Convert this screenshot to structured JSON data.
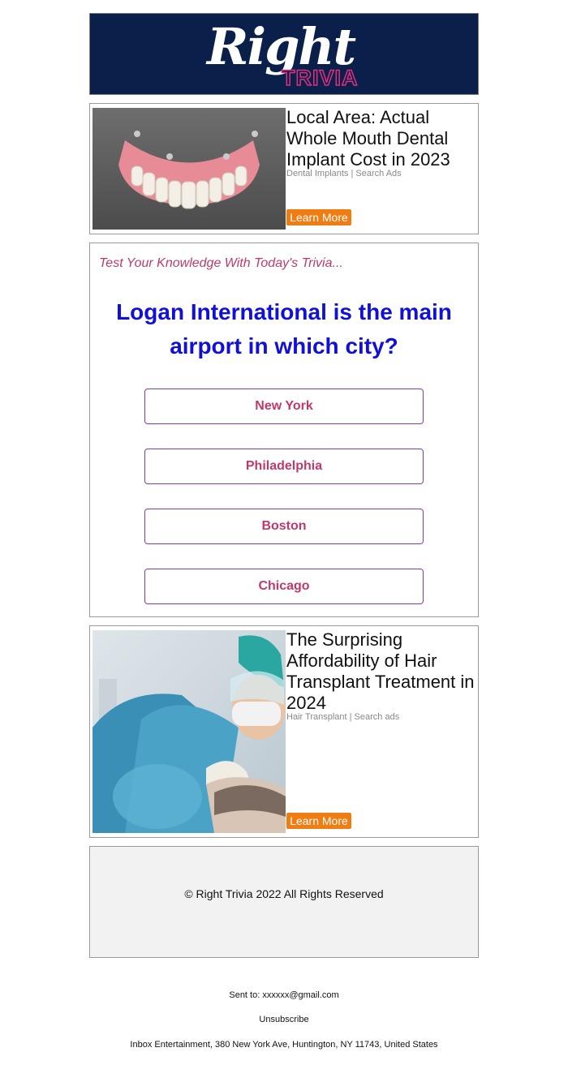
{
  "header": {
    "logo_right": "Right",
    "logo_trivia": "TRIVIA"
  },
  "ad_top": {
    "title": "Local Area: Actual Whole Mouth Dental Implant Cost in 2023",
    "source": "Dental Implants | Search Ads",
    "cta": "Learn More"
  },
  "trivia": {
    "tagline": "Test Your Knowledge With Today's Trivia...",
    "question": "Logan International is the main airport in which city?",
    "answers": [
      "New York",
      "Philadelphia",
      "Boston",
      "Chicago"
    ]
  },
  "ad_bottom": {
    "title": "The Surprising Affordability of Hair Transplant Treatment in 2024",
    "source": "Hair Transplant | Search ads",
    "cta": "Learn More"
  },
  "footer": {
    "copyright": "© Right Trivia 2022 All Rights Reserved",
    "sent_to": "Sent to: xxxxxx@gmail.com",
    "unsubscribe": "Unsubscribe",
    "address": "Inbox Entertainment, 380 New York Ave, Huntington, NY 11743, United States"
  },
  "colors": {
    "header_bg": "#0a1f4a",
    "question": "#1010d8",
    "answer_text": "#c0396b",
    "cta_bg": "#f07d12"
  }
}
